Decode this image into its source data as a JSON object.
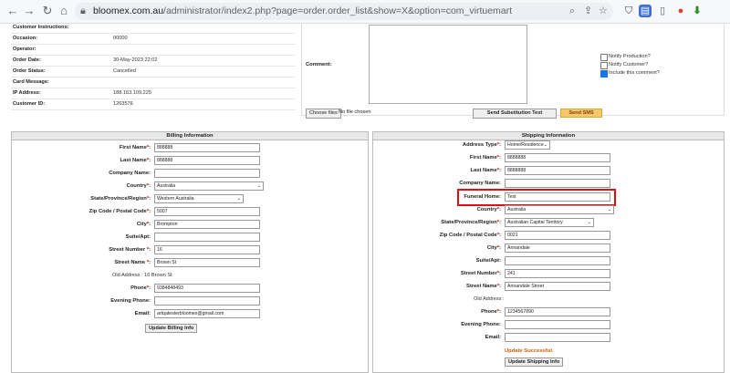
{
  "browser": {
    "url_host": "bloomex.com.au",
    "url_path": "/administrator/index2.php?page=order.order_list&show=X&option=com_virtuemart"
  },
  "order": {
    "rows": [
      {
        "k": "Customer Instructions:",
        "v": ""
      },
      {
        "k": "Occasion:",
        "v": "00000"
      },
      {
        "k": "Operator:",
        "v": ""
      },
      {
        "k": "Order Date:",
        "v": "30-May-2023 22:02"
      },
      {
        "k": "Order Status:",
        "v": "Cancelled"
      },
      {
        "k": "Card Message:",
        "v": ""
      },
      {
        "k": "IP Address:",
        "v": "188.163.109.225"
      },
      {
        "k": "Customer ID:",
        "v": "1263576"
      }
    ]
  },
  "comment": {
    "label": "Comment:",
    "notify_production": "Notify Production?",
    "notify_customer": "Notify Customer?",
    "include_comment": "Include this comment?",
    "file_button": "Choose files",
    "file_none": "No file chosen",
    "send_subs": "Send Substitution Text",
    "send_sms": "Send SMS"
  },
  "billing": {
    "title": "Billing Information",
    "first_name_lbl": "First Name",
    "first_name": "888888",
    "last_name_lbl": "Last Name",
    "last_name": "888888",
    "company_lbl": "Company Name:",
    "company": "",
    "country_lbl": "Country",
    "country": "Australia",
    "state_lbl": "State/Province/Region",
    "state": "Western Australia",
    "zip_lbl": "Zip Code / Postal Code",
    "zip": "5007",
    "city_lbl": "City",
    "city": "Brompton",
    "suite_lbl": "Suite/Apt:",
    "suite": "",
    "street_num_lbl": "Street Number",
    "street_num": "16",
    "street_name_lbl": "Street Name",
    "street_name": "Brown St",
    "old_address": "Old Address : 16 Brown St",
    "phone_lbl": "Phone",
    "phone": "9384848493",
    "evening_lbl": "Evening Phone:",
    "evening": "",
    "email_lbl": "Email:",
    "email": "artqatesterbloomex@gmail.com",
    "update_btn": "Update Billing Info"
  },
  "shipping": {
    "title": "Shipping Information",
    "addr_type_lbl": "Address Type",
    "addr_type": "Home/Residence",
    "first_name_lbl": "First Name",
    "first_name": "8888888",
    "last_name_lbl": "Last Name",
    "last_name": "8888888",
    "company_lbl": "Company Name:",
    "company": "",
    "funeral_lbl": "Funeral Home:",
    "funeral": "Test",
    "country_lbl": "Country",
    "country": "Australia",
    "state_lbl": "State/Province/Region",
    "state": "Australian Capital Territory",
    "zip_lbl": "Zip Code / Postal Code",
    "zip": "0021",
    "city_lbl": "City",
    "city": "Annandale",
    "suite_lbl": "Suite/Apt:",
    "suite": "",
    "street_num_lbl": "Street Number",
    "street_num": "241",
    "street_name_lbl": "Street Name",
    "street_name": "Annandale Street",
    "old_address": "Old Address :",
    "phone_lbl": "Phone",
    "phone": "1234567890",
    "evening_lbl": "Evening Phone:",
    "evening": "",
    "email_lbl": "Email:",
    "email": "",
    "success": "Update Successful.",
    "update_btn": "Update Shipping Info"
  },
  "colors": {
    "required": "#cc0000",
    "highlight": "#e01010",
    "success": "#e05a00"
  }
}
